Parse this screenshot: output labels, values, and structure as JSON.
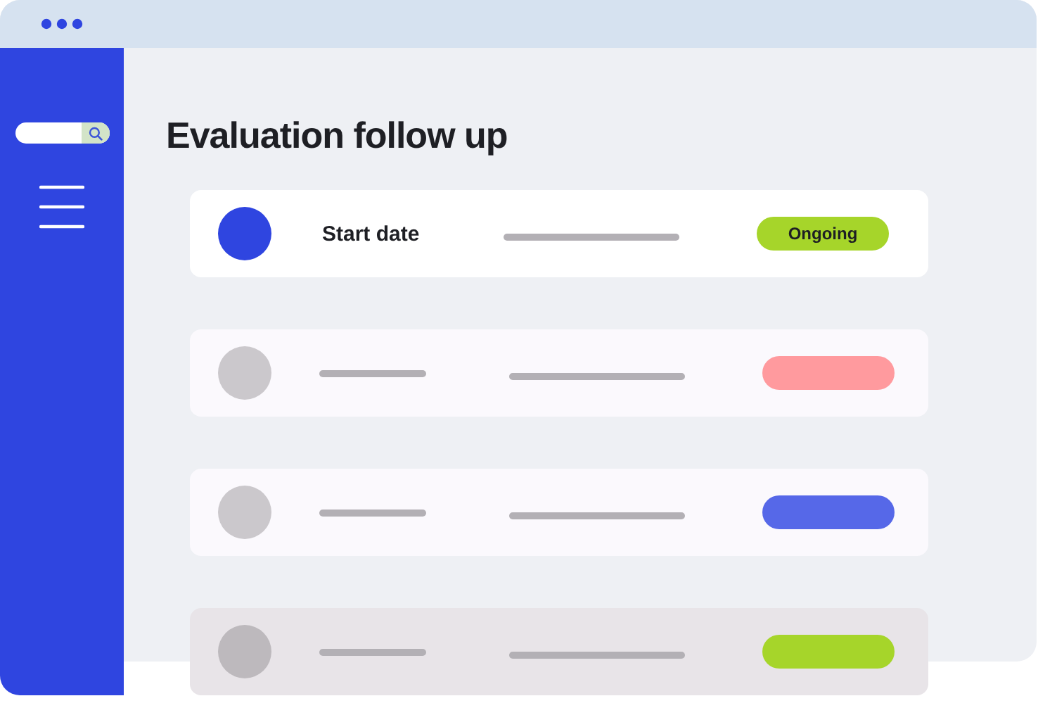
{
  "page_title": "Evaluation follow up",
  "rows": [
    {
      "kind": "active",
      "label": "Start date",
      "status": "Ongoing",
      "color": "#a6d52a"
    },
    {
      "kind": "placeholder",
      "color": "#ff9a9e"
    },
    {
      "kind": "placeholder",
      "color": "#5668e8"
    },
    {
      "kind": "dimmed",
      "color": "#a6d52a"
    }
  ]
}
